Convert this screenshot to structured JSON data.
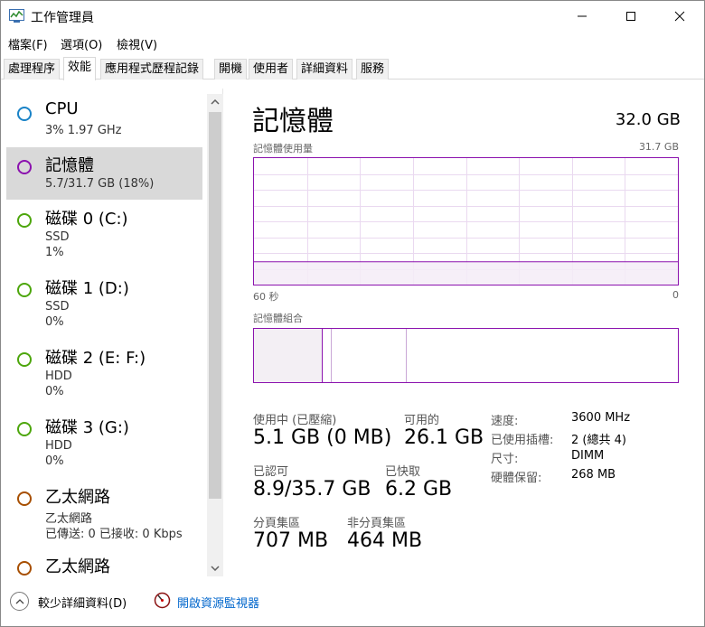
{
  "window": {
    "title": "工作管理員"
  },
  "menu": {
    "file": "檔案(F)",
    "options": "選項(O)",
    "view": "檢視(V)"
  },
  "tabs": [
    {
      "label": "處理程序"
    },
    {
      "label": "效能"
    },
    {
      "label": "應用程式歷程記錄"
    },
    {
      "label": "開機"
    },
    {
      "label": "使用者"
    },
    {
      "label": "詳細資料"
    },
    {
      "label": "服務"
    }
  ],
  "sidebar": {
    "items": [
      {
        "name": "CPU",
        "line2": "3%  1.97 GHz",
        "line3": "",
        "color": "#1a83c7"
      },
      {
        "name": "記憶體",
        "line2": "5.7/31.7 GB (18%)",
        "line3": "",
        "color": "#8b12ae"
      },
      {
        "name": "磁碟 0 (C:)",
        "line2": "SSD",
        "line3": "1%",
        "color": "#4da60c"
      },
      {
        "name": "磁碟 1 (D:)",
        "line2": "SSD",
        "line3": "0%",
        "color": "#4da60c"
      },
      {
        "name": "磁碟 2 (E: F:)",
        "line2": "HDD",
        "line3": "0%",
        "color": "#4da60c"
      },
      {
        "name": "磁碟 3 (G:)",
        "line2": "HDD",
        "line3": "0%",
        "color": "#4da60c"
      },
      {
        "name": "乙太網路",
        "line2": "乙太網路",
        "line3": "已傳送: 0  已接收: 0 Kbps",
        "color": "#a74f01"
      },
      {
        "name": "乙太網路",
        "line2": "",
        "line3": "",
        "color": "#a74f01"
      }
    ]
  },
  "main": {
    "title": "記憶體",
    "total": "32.0 GB",
    "usage_label": "記憶體使用量",
    "usage_max": "31.7 GB",
    "time_label": "60 秒",
    "time_end": "0",
    "composition_label": "記憶體組合",
    "usage_fraction": 0.18,
    "stats": {
      "in_use_label": "使用中 (已壓縮)",
      "in_use_value": "5.1 GB (0 MB)",
      "available_label": "可用的",
      "available_value": "26.1 GB",
      "committed_label": "已認可",
      "committed_value": "8.9/35.7 GB",
      "cached_label": "已快取",
      "cached_value": "6.2 GB",
      "paged_label": "分頁集區",
      "paged_value": "707 MB",
      "nonpaged_label": "非分頁集區",
      "nonpaged_value": "464 MB"
    },
    "details": {
      "speed_label": "速度:",
      "speed_value": "3600 MHz",
      "slots_label": "已使用插槽:",
      "slots_value": "2 (總共 4)",
      "form_label": "尺寸:",
      "form_value": "DIMM",
      "reserved_label": "硬體保留:",
      "reserved_value": "268 MB"
    }
  },
  "footer": {
    "fewer_details": "較少詳細資料(D)",
    "open_monitor": "開啟資源監視器"
  },
  "colors": {
    "memory": "#8b12ae",
    "link": "#0066cc"
  }
}
